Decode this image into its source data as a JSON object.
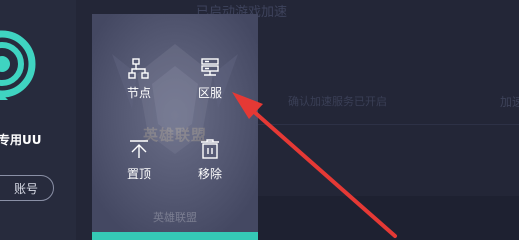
{
  "sidebar": {
    "brand_partial": "专用UU",
    "account_button": "账号"
  },
  "main": {
    "title_partial": "已启动游戏加速",
    "hint_partial": "确认加速服务已开启",
    "hint_right_partial": "加速"
  },
  "game_card": {
    "watermark": "英雄联盟",
    "label": "英雄联盟",
    "accent_color": "#35c9b6"
  },
  "menu": {
    "items": [
      {
        "label": "节点",
        "icon": "node-icon"
      },
      {
        "label": "区服",
        "icon": "server-region-icon"
      },
      {
        "label": "置顶",
        "icon": "pin-top-icon"
      },
      {
        "label": "移除",
        "icon": "trash-icon"
      }
    ]
  },
  "annotation": {
    "arrow_color": "#e53935"
  }
}
